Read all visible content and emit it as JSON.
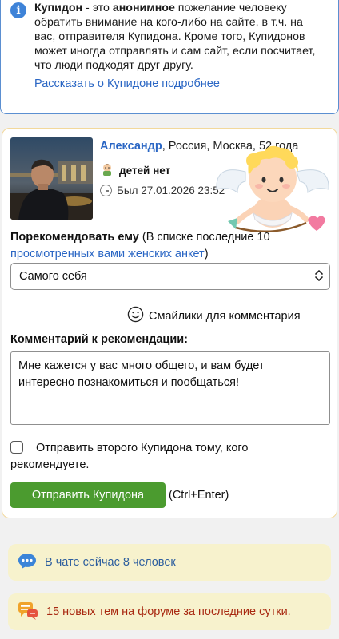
{
  "info": {
    "term": "Купидон",
    "text_part1": " - это ",
    "emphasis": "анонимное",
    "text_part2": " пожелание человеку обратить внимание на кого-либо на сайте, в т.ч. на вас, отправителя Купидона. Кроме того, Купидонов может иногда отправлять и сам сайт, если посчитает, что люди подходят друг другу.",
    "link": "Рассказать о Купидоне подробнее"
  },
  "profile": {
    "name": "Александр",
    "details": ", Россия, Москва, 52 года",
    "kids": "детей нет",
    "last_seen": "Был 27.01.2026 23:52"
  },
  "recommend": {
    "label_bold": "Порекомендовать ему",
    "label_rest": " (В списке последние 10 ",
    "label_link": "просмотренных вами женских анкет",
    "label_end": ")",
    "selected": "Самого себя"
  },
  "smileys_label": "Смайлики для комментария",
  "comment": {
    "label": "Комментарий к рекомендации:",
    "value": "Мне кажется у вас много общего, и вам будет интересно познакомиться и пообщаться!"
  },
  "second_cupid_label": "Отправить второго Купидона тому, кого рекомендуете.",
  "send_button": "Отправить Купидона",
  "shortcut": "(Ctrl+Enter)",
  "chat_notice": "В чате сейчас 8 человек",
  "forum_notice": "15 новых тем на форуме за последние сутки."
}
